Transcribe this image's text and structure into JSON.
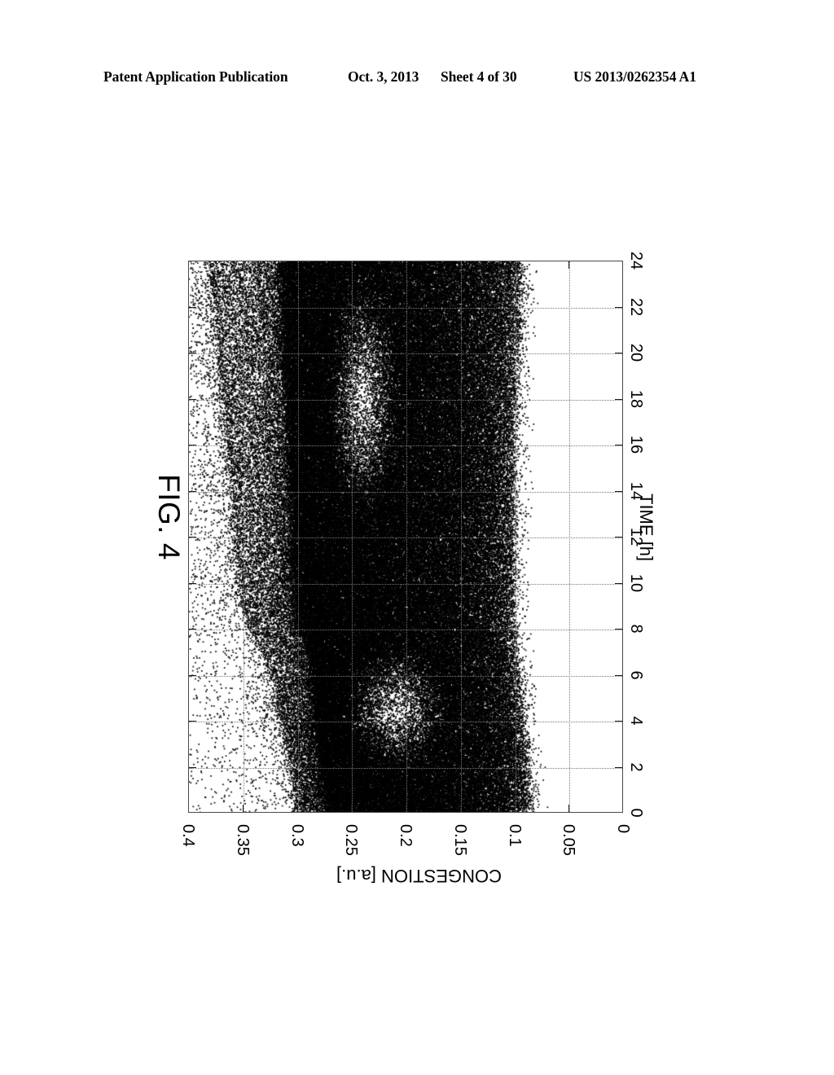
{
  "header": {
    "publication": "Patent Application Publication",
    "date": "Oct. 3, 2013",
    "sheet": "Sheet 4 of 30",
    "document_number": "US 2013/0262354 A1"
  },
  "figure": {
    "caption": "FIG. 4"
  },
  "chart_data": {
    "type": "scatter",
    "title": "FIG. 4",
    "orientation": "rotated-90-clockwise",
    "xlabel": "TIME [h]",
    "ylabel": "CONGESTION [a.u.]",
    "xlim": [
      0,
      24
    ],
    "ylim": [
      0,
      0.4
    ],
    "x_ticks": [
      0,
      2,
      4,
      6,
      8,
      10,
      12,
      14,
      16,
      18,
      20,
      22,
      24
    ],
    "x_tick_labels": [
      "0",
      "2",
      "4",
      "6",
      "8",
      "10",
      "12",
      "14",
      "16",
      "18",
      "20",
      "22",
      "24"
    ],
    "y_ticks": [
      0,
      0.05,
      0.1,
      0.15,
      0.2,
      0.25,
      0.3,
      0.35,
      0.4
    ],
    "y_tick_labels": [
      "0",
      "0.05",
      "0.1",
      "0.15",
      "0.2",
      "0.25",
      "0.3",
      "0.35",
      "0.4"
    ],
    "grid": true,
    "legend": "none",
    "marker": {
      "shape": "dot",
      "color": "#000000",
      "size": 1.6
    },
    "description": "Very dense scatter cloud of congestion measurements versus time of day. Points occupy a band whose lower edge stays near 0.08-0.10 for all hours and whose upper edge varies with time of day.",
    "point_count_approx": 120000,
    "density_envelope": {
      "note": "per-hour approximate lower bound, dense-core upper bound, and sparse-tail upper bound of the point cloud (congestion, a.u.)",
      "hours": [
        0,
        1,
        2,
        3,
        4,
        5,
        6,
        7,
        8,
        9,
        10,
        11,
        12,
        13,
        14,
        15,
        16,
        17,
        18,
        19,
        20,
        21,
        22,
        23,
        24
      ],
      "lower": [
        0.085,
        0.086,
        0.088,
        0.09,
        0.092,
        0.094,
        0.096,
        0.098,
        0.1,
        0.101,
        0.101,
        0.1,
        0.1,
        0.1,
        0.1,
        0.1,
        0.1,
        0.1,
        0.099,
        0.098,
        0.097,
        0.096,
        0.095,
        0.094,
        0.093
      ],
      "dense_upper": [
        0.27,
        0.272,
        0.275,
        0.278,
        0.28,
        0.281,
        0.283,
        0.288,
        0.295,
        0.3,
        0.302,
        0.303,
        0.303,
        0.303,
        0.304,
        0.305,
        0.306,
        0.307,
        0.308,
        0.309,
        0.31,
        0.311,
        0.312,
        0.313,
        0.313
      ],
      "sparse_upper": [
        0.3,
        0.302,
        0.305,
        0.31,
        0.315,
        0.318,
        0.322,
        0.33,
        0.34,
        0.348,
        0.352,
        0.355,
        0.356,
        0.357,
        0.358,
        0.36,
        0.362,
        0.364,
        0.366,
        0.368,
        0.37,
        0.372,
        0.374,
        0.376,
        0.378
      ]
    },
    "void_region": {
      "note": "a lighter, lower-density pocket inside the cloud",
      "hour_range": [
        1.5,
        7.5
      ],
      "congestion_range": [
        0.16,
        0.26
      ]
    },
    "second_void_region": {
      "note": "a second lighter, lower-density pocket at later hours",
      "hour_range": [
        12.5,
        23.5
      ],
      "congestion_range": [
        0.205,
        0.275
      ]
    }
  }
}
